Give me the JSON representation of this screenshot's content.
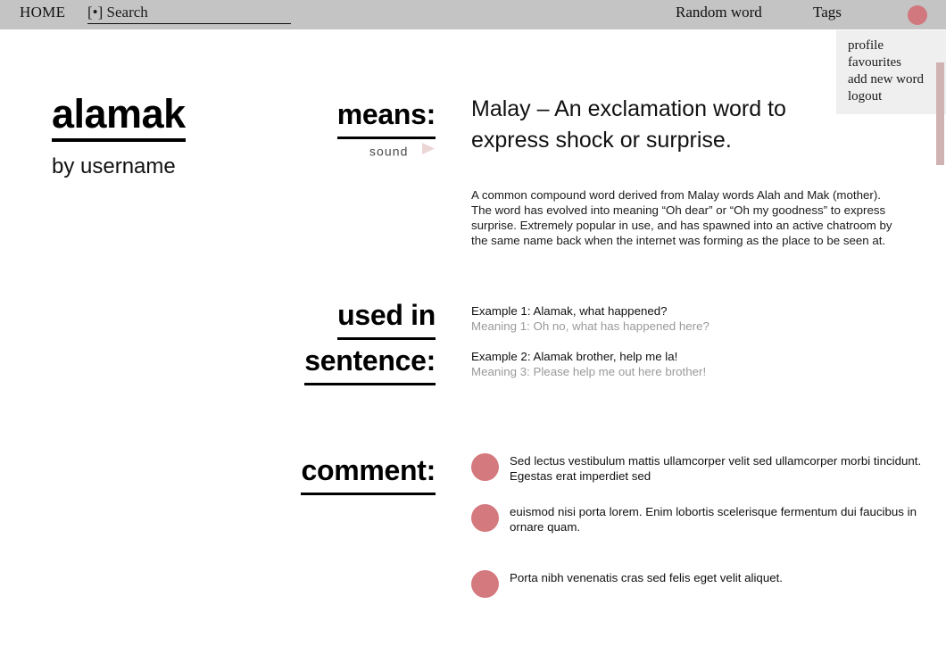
{
  "header": {
    "home_label": "HOME",
    "search_value": "[•] Search",
    "search_placeholder": "Search",
    "random_word_label": "Random word",
    "tags_label": "Tags",
    "avatar_color": "#d1787e"
  },
  "dropdown": {
    "items": [
      {
        "label": "profile"
      },
      {
        "label": "favourites"
      },
      {
        "label": "add new word"
      },
      {
        "label": "logout"
      }
    ]
  },
  "word": {
    "title": "alamak",
    "author": "by username"
  },
  "means_section": {
    "label": "means:",
    "sound_label": "sound",
    "definition": "Malay – An exclamation word to express shock or surprise.",
    "description": "A common compound word derived from Malay words Alah and Mak (mother). The word has evolved into meaning “Oh dear” or “Oh my goodness” to express surprise. Extremely popular in use, and has spawned into an active chatroom by the same name back when the internet was forming as the place to be seen at."
  },
  "used_in_sentence_section": {
    "label_line1": "used in",
    "label_line2": "sentence:",
    "examples": [
      {
        "example": "Example 1: Alamak, what happened?",
        "meaning": "Meaning 1: Oh no, what has happened here?"
      },
      {
        "example": "Example 2: Alamak brother, help me la!",
        "meaning": "Meaning 3: Please help me out here brother!"
      }
    ]
  },
  "comment_section": {
    "label": "comment:",
    "avatar_color": "#d4797e",
    "comments": [
      {
        "text": "Sed lectus vestibulum mattis ullamcorper velit sed ullamcorper morbi tincidunt. Egestas erat imperdiet sed"
      },
      {
        "text": "euismod nisi porta lorem. Enim lobortis scelerisque fermentum dui faucibus in ornare quam."
      },
      {
        "text": "Porta nibh venenatis cras sed felis eget velit aliquet."
      }
    ]
  },
  "scrollbar": {
    "thumb_color": "#cfb3b3"
  }
}
